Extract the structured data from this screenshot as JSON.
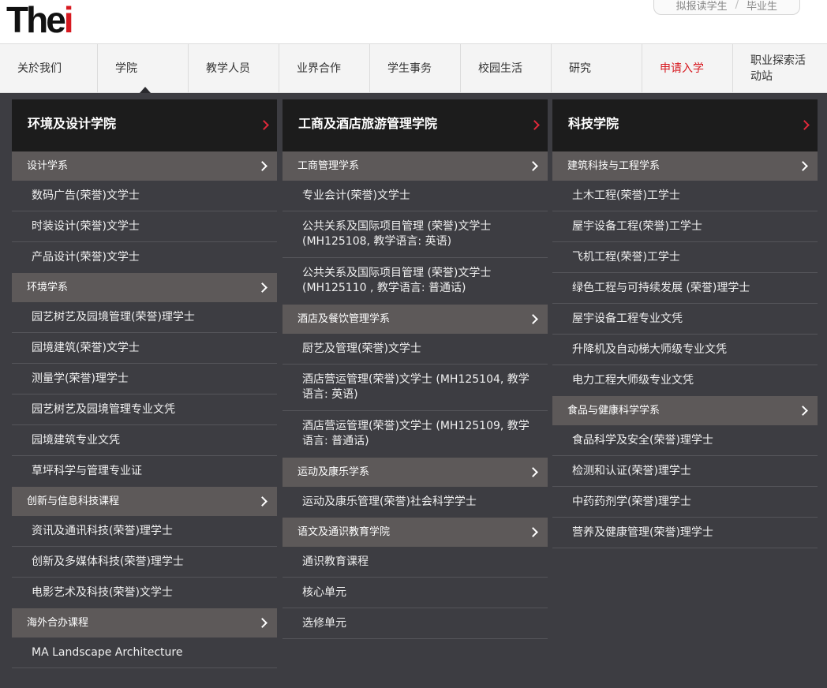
{
  "header": {
    "logo_text_black": "The",
    "logo_text_red": "i",
    "utility": [
      "拟报读学生",
      "毕业生"
    ]
  },
  "nav": {
    "items": [
      "关於我们",
      "学院",
      "教学人员",
      "业界合作",
      "学生事务",
      "校园生活",
      "研究",
      "申请入学",
      "职业探索活动站"
    ],
    "active_index": 1,
    "highlight_color": "#d71920"
  },
  "menu": {
    "columns": [
      {
        "title": "环境及设计学院",
        "groups": [
          {
            "name": "设计学系",
            "items": [
              "数码广告(荣誉)文学士",
              "时装设计(荣誉)文学士",
              "产品设计(荣誉)文学士"
            ]
          },
          {
            "name": "环境学系",
            "items": [
              "园艺树艺及园境管理(荣誉)理学士",
              "园境建筑(荣誉)文学士",
              "测量学(荣誉)理学士",
              "园艺树艺及园境管理专业文凭",
              "园境建筑专业文凭",
              "草坪科学与管理专业证"
            ]
          },
          {
            "name": "创新与信息科技课程",
            "items": [
              "资讯及通讯科技(荣誉)理学士",
              "创新及多媒体科技(荣誉)理学士",
              "电影艺术及科技(荣誉)文学士"
            ]
          },
          {
            "name": "海外合办课程",
            "items": [
              "MA Landscape Architecture"
            ]
          }
        ]
      },
      {
        "title": "工商及酒店旅游管理学院",
        "groups": [
          {
            "name": "工商管理学系",
            "items": [
              "专业会计(荣誉)文学士",
              "公共关系及国际项目管理 (荣誉)文学士 (MH125108, 教学语言: 英语)",
              "公共关系及国际项目管理 (荣誉)文学士 (MH125110 , 教学语言: 普通话)"
            ]
          },
          {
            "name": "酒店及餐饮管理学系",
            "items": [
              "厨艺及管理(荣誉)文学士",
              "酒店营运管理(荣誉)文学士 (MH125104, 教学语言: 英语)",
              "酒店营运管理(荣誉)文学士 (MH125109, 教学语言: 普通话)"
            ]
          },
          {
            "name": "运动及康乐学系",
            "items": [
              "运动及康乐管理(荣誉)社会科学学士"
            ]
          },
          {
            "name": "语文及通识教育学院",
            "items": [
              "通识教育课程",
              "核心单元",
              "选修单元"
            ]
          }
        ]
      },
      {
        "title": "科技学院",
        "groups": [
          {
            "name": "建筑科技与工程学系",
            "items": [
              "土木工程(荣誉)工学士",
              "屋宇设备工程(荣誉)工学士",
              "飞机工程(荣誉)工学士",
              "绿色工程与可持续发展 (荣誉)理学士",
              "屋宇设备工程专业文凭",
              "升降机及自动梯大师级专业文凭",
              "电力工程大师级专业文凭"
            ]
          },
          {
            "name": "食品与健康科学学系",
            "items": [
              "食品科学及安全(荣誉)理学士",
              "检测和认证(荣誉)理学士",
              "中药药剂学(荣誉)理学士",
              "营养及健康管理(荣誉)理学士"
            ]
          }
        ]
      }
    ]
  }
}
